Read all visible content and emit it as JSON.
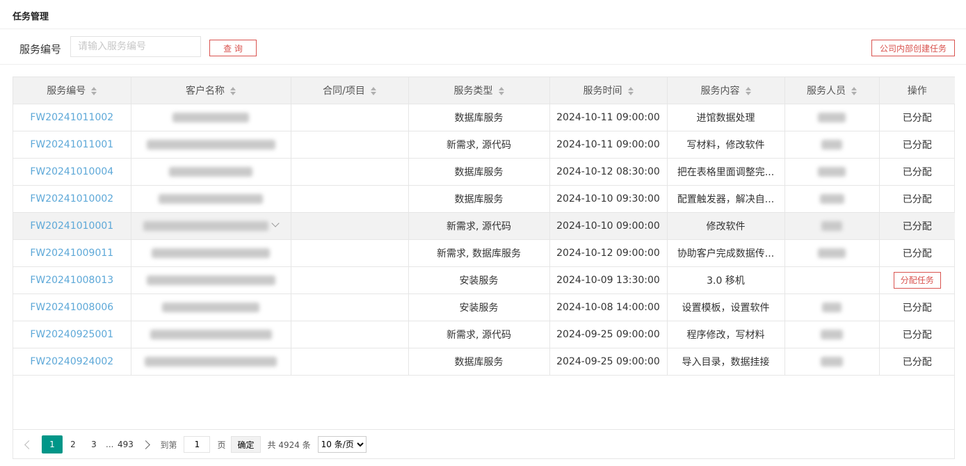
{
  "page": {
    "title": "任务管理"
  },
  "search": {
    "label": "服务编号",
    "placeholder": "请输入服务编号",
    "value": "",
    "query_label": "查 询"
  },
  "actions": {
    "create_label": "公司内部创建任务"
  },
  "table": {
    "columns": [
      {
        "label": "服务编号",
        "sortable": true
      },
      {
        "label": "客户名称",
        "sortable": true
      },
      {
        "label": "合同/项目",
        "sortable": true
      },
      {
        "label": "服务类型",
        "sortable": true
      },
      {
        "label": "服务时间",
        "sortable": true
      },
      {
        "label": "服务内容",
        "sortable": true
      },
      {
        "label": "服务人员",
        "sortable": true
      },
      {
        "label": "操作",
        "sortable": false
      }
    ],
    "rows": [
      {
        "code": "FW20241011002",
        "type": "数据库服务",
        "time": "2024-10-11 09:00:00",
        "content": "进馆数据处理",
        "action": "已分配"
      },
      {
        "code": "FW20241011001",
        "type": "新需求, 源代码",
        "time": "2024-10-11 09:00:00",
        "content": "写材料，修改软件",
        "action": "已分配"
      },
      {
        "code": "FW20241010004",
        "type": "数据库服务",
        "time": "2024-10-12 08:30:00",
        "content": "把在表格里面调整完...",
        "action": "已分配"
      },
      {
        "code": "FW20241010002",
        "type": "数据库服务",
        "time": "2024-10-10 09:30:00",
        "content": "配置触发器，解决自...",
        "action": "已分配"
      },
      {
        "code": "FW20241010001",
        "type": "新需求, 源代码",
        "time": "2024-10-10 09:00:00",
        "content": "修改软件",
        "action": "已分配"
      },
      {
        "code": "FW20241009011",
        "type": "新需求, 数据库服务",
        "time": "2024-10-12 09:00:00",
        "content": "协助客户完成数据传...",
        "action": "已分配"
      },
      {
        "code": "FW20241008013",
        "type": "安装服务",
        "time": "2024-10-09 13:30:00",
        "content": "3.0 移机",
        "action": "分配任务"
      },
      {
        "code": "FW20241008006",
        "type": "安装服务",
        "time": "2024-10-08 14:00:00",
        "content": "设置模板，设置软件",
        "action": "已分配"
      },
      {
        "code": "FW20240925001",
        "type": "新需求, 源代码",
        "time": "2024-09-25 09:00:00",
        "content": "程序修改，写材料",
        "action": "已分配"
      },
      {
        "code": "FW20240924002",
        "type": "数据库服务",
        "time": "2024-09-25 09:00:00",
        "content": "导入目录，数据挂接",
        "action": "已分配"
      }
    ]
  },
  "pagination": {
    "current": "1",
    "pages": [
      "1",
      "2",
      "3"
    ],
    "ellipsis": "...",
    "last": "493",
    "goto_label": "到第",
    "goto_value": "1",
    "page_unit": "页",
    "confirm_label": "确定",
    "total_label": "共 4924 条",
    "page_size_label": "10 条/页"
  },
  "colors": {
    "link": "#5da8d8",
    "danger": "#d9534f",
    "active_page": "#009688"
  }
}
